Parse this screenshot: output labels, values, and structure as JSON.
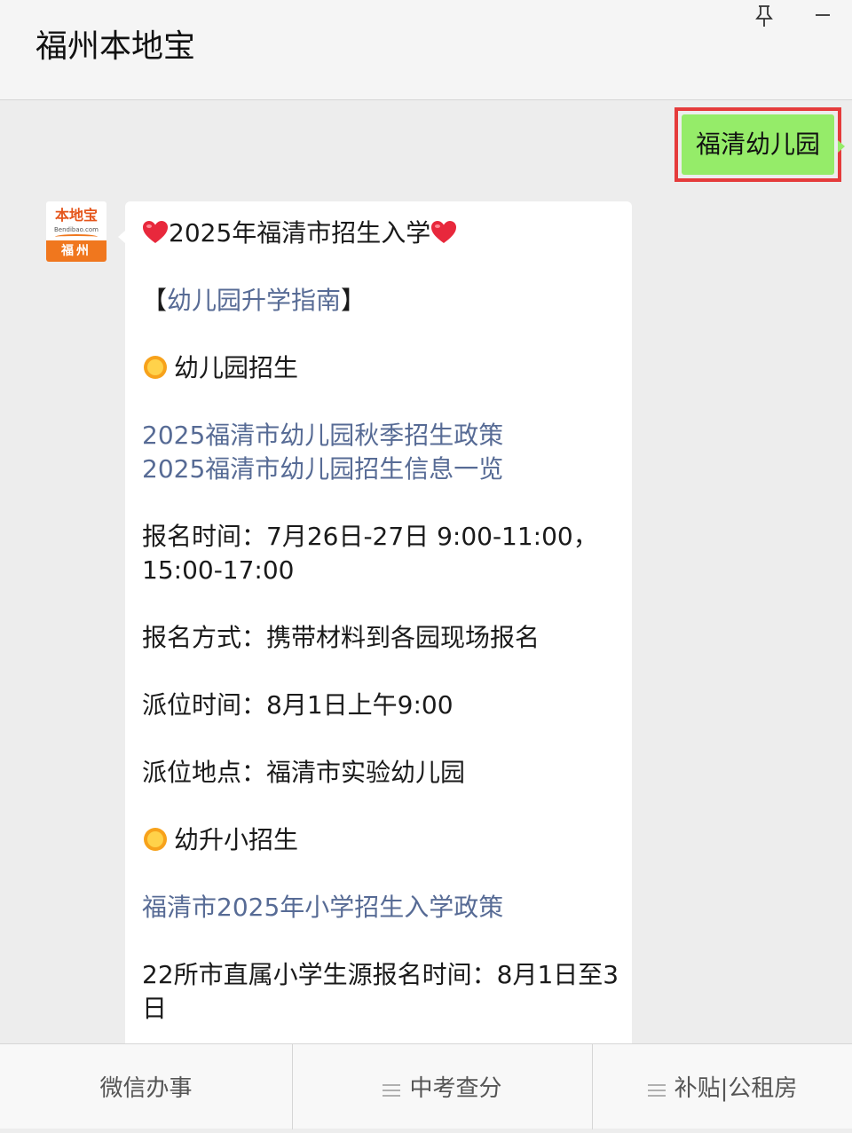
{
  "window": {
    "title": "福州本地宝",
    "pin_icon": "pin-icon",
    "minimize_icon": "minimize-icon"
  },
  "sent_message": {
    "text": "福清幼儿园",
    "highlight_color": "#e53b3b",
    "bubble_color": "#95ec69"
  },
  "avatar": {
    "logo_text": "本地宝",
    "logo_sub": "Bendibao.com",
    "city": "福州"
  },
  "reply": {
    "headline": "2025年福清市招生入学",
    "guide_open": "【",
    "guide_link": "幼儿园升学指南",
    "guide_close": "】",
    "section1": "幼儿园招生",
    "link1": "2025福清市幼儿园秋季招生政策",
    "link2": "2025福清市幼儿园招生信息一览",
    "reg_time_1": "报名时间：7月26日-27日 9:00-11:00，",
    "reg_time_2": "15:00-17:00",
    "reg_method": "报名方式：携带材料到各园现场报名",
    "assign_time": "派位时间：8月1日上午9:00",
    "assign_place": "派位地点：福清市实验幼儿园",
    "section2": "幼升小招生",
    "link3": "福清市2025年小学招生入学政策",
    "primary_1": "22所市直属小学生源报名时间：8月1日至3",
    "primary_2": "日",
    "link_color": "#576b95"
  },
  "bottom_menu": {
    "tabs": [
      {
        "label": "微信办事",
        "icon": ""
      },
      {
        "label": "中考查分",
        "icon": "menu-icon"
      },
      {
        "label": "补贴|公租房",
        "icon": "menu-icon"
      }
    ]
  }
}
